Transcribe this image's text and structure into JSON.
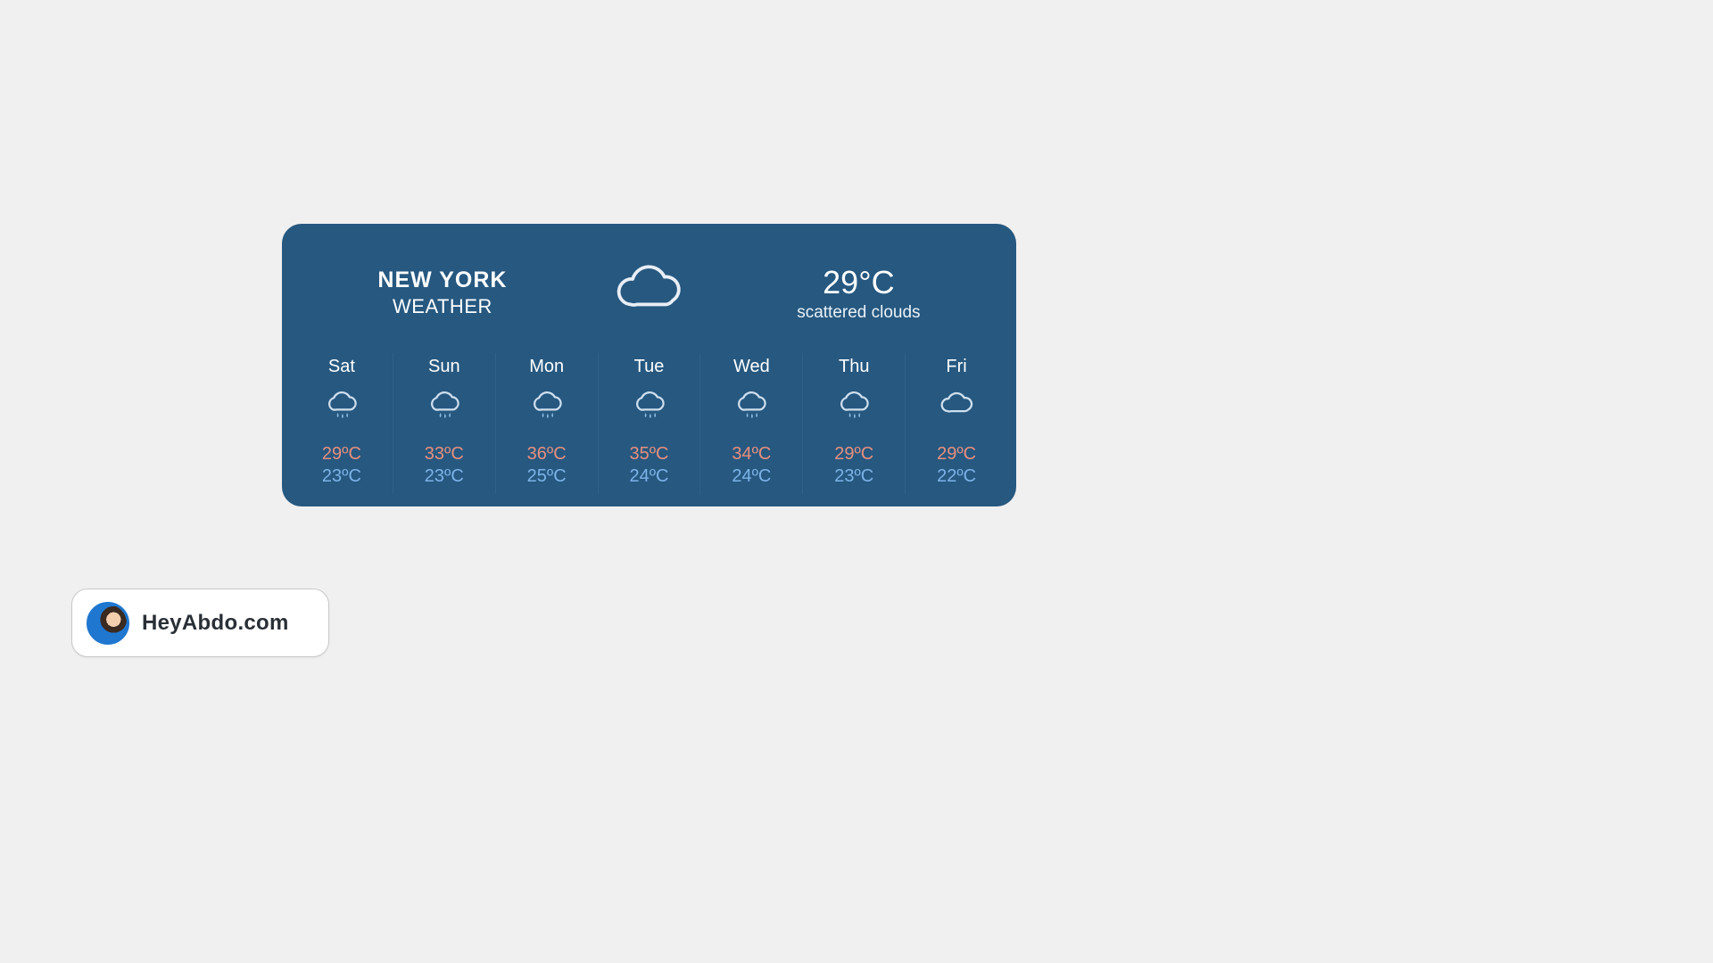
{
  "weather": {
    "location": "NEW YORK",
    "label": "WEATHER",
    "currentTemp": "29°C",
    "currentDesc": "scattered clouds",
    "currentIcon": "cloud-icon",
    "forecast": [
      {
        "day": "Sat",
        "icon": "rain-cloud-icon",
        "high": "29ºC",
        "low": "23ºC"
      },
      {
        "day": "Sun",
        "icon": "rain-cloud-icon",
        "high": "33ºC",
        "low": "23ºC"
      },
      {
        "day": "Mon",
        "icon": "rain-cloud-icon",
        "high": "36ºC",
        "low": "25ºC"
      },
      {
        "day": "Tue",
        "icon": "rain-cloud-icon",
        "high": "35ºC",
        "low": "24ºC"
      },
      {
        "day": "Wed",
        "icon": "rain-cloud-icon",
        "high": "34ºC",
        "low": "24ºC"
      },
      {
        "day": "Thu",
        "icon": "rain-cloud-icon",
        "high": "29ºC",
        "low": "23ºC"
      },
      {
        "day": "Fri",
        "icon": "cloud-icon",
        "high": "29ºC",
        "low": "22ºC"
      }
    ]
  },
  "badge": {
    "text": "HeyAbdo.com"
  }
}
